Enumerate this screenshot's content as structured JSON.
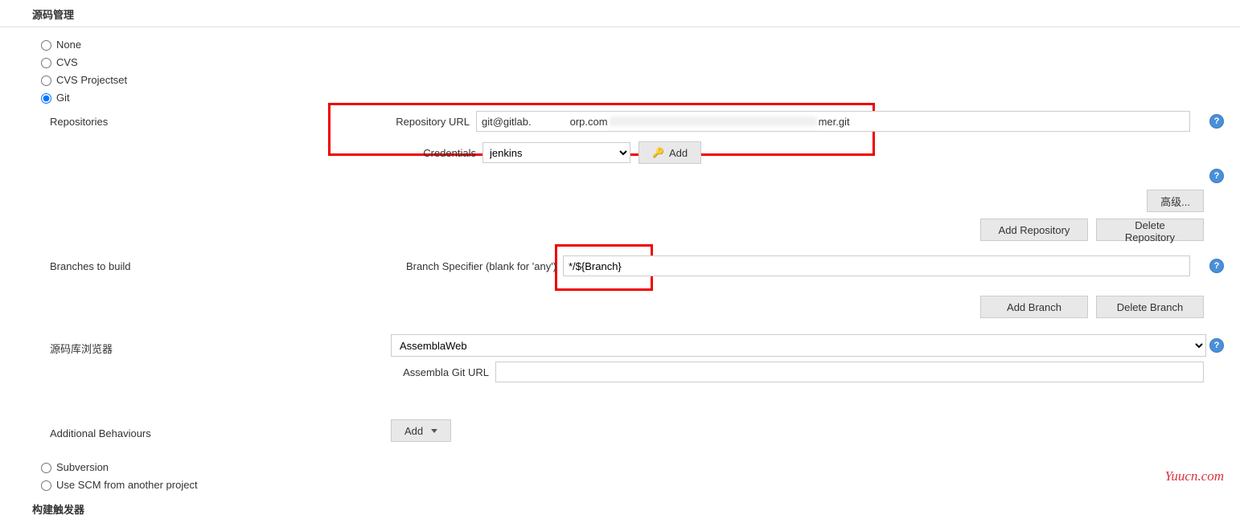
{
  "section_scm_title": "源码管理",
  "scm_options": {
    "none": "None",
    "cvs": "CVS",
    "cvs_projectset": "CVS Projectset",
    "git": "Git",
    "subversion": "Subversion",
    "use_scm_from": "Use SCM from another project"
  },
  "git": {
    "repositories_label": "Repositories",
    "repo_url_label": "Repository URL",
    "repo_url_value_left": "git@gitlab.",
    "repo_url_value_mid": "orp.com",
    "repo_url_value_right": "mer.git",
    "credentials_label": "Credentials",
    "credentials_value": "jenkins",
    "add_cred_label": "Add",
    "advanced_label": "高级...",
    "add_repo_label": "Add Repository",
    "delete_repo_label": "Delete Repository",
    "branches_label": "Branches to build",
    "branch_specifier_label": "Branch Specifier (blank for 'any')",
    "branch_specifier_value": "*/${Branch}",
    "add_branch_label": "Add Branch",
    "delete_branch_label": "Delete Branch",
    "browser_label": "源码库浏览器",
    "browser_value": "AssemblaWeb",
    "assembla_url_label": "Assembla Git URL",
    "assembla_url_value": "",
    "additional_behaviours_label": "Additional Behaviours",
    "add_behaviour_label": "Add"
  },
  "section_triggers_title": "构建触发器",
  "watermark": "Yuucn.com",
  "help_glyph": "?"
}
